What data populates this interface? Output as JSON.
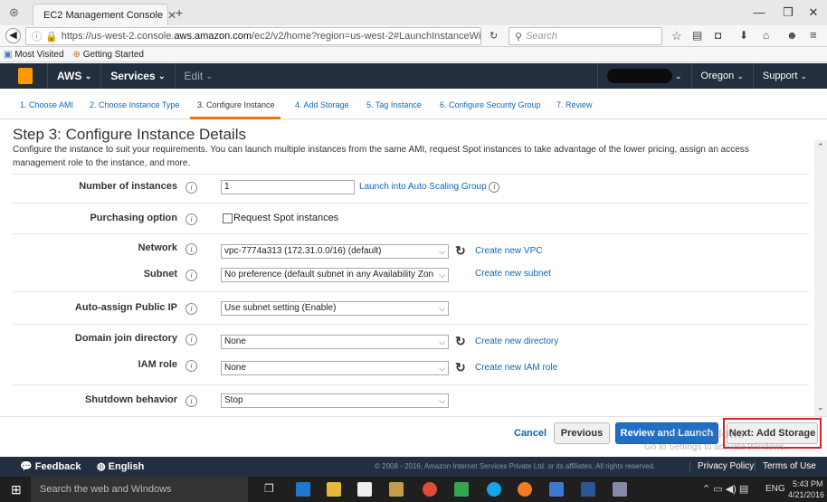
{
  "browser": {
    "tab_title": "EC2 Management Console",
    "url_prefix": "https://us-west-2.console.",
    "url_domain": "aws.amazon.com",
    "url_suffix": "/ec2/v2/home?region=us-west-2#LaunchInstanceWizard:",
    "search_placeholder": "Search",
    "bookmarks": [
      "Most Visited",
      "Getting Started"
    ]
  },
  "aws_nav": {
    "aws_label": "AWS",
    "services_label": "Services",
    "edit_label": "Edit",
    "region_label": "Oregon",
    "support_label": "Support"
  },
  "wizard": {
    "steps": [
      "1. Choose AMI",
      "2. Choose Instance Type",
      "3. Configure Instance",
      "4. Add Storage",
      "5. Tag Instance",
      "6. Configure Security Group",
      "7. Review"
    ],
    "active_step": 3,
    "heading": "Step 3: Configure Instance Details",
    "description": "Configure the instance to suit your requirements. You can launch multiple instances from the same AMI, request Spot instances to take advantage of the lower pricing, assign an access management role to the instance, and more."
  },
  "form": {
    "number_of_instances_label": "Number of instances",
    "number_of_instances_value": "1",
    "launch_asg_link": "Launch into Auto Scaling Group",
    "purchasing_option_label": "Purchasing option",
    "spot_checkbox_label": "Request Spot instances",
    "network_label": "Network",
    "network_value": "vpc-7774a313 (172.31.0.0/16) (default)",
    "create_vpc_link": "Create new VPC",
    "subnet_label": "Subnet",
    "subnet_value": "No preference (default subnet in any Availability Zon",
    "create_subnet_link": "Create new subnet",
    "public_ip_label": "Auto-assign Public IP",
    "public_ip_value": "Use subnet setting (Enable)",
    "domain_label": "Domain join directory",
    "domain_value": "None",
    "create_directory_link": "Create new directory",
    "iam_label": "IAM role",
    "iam_value": "None",
    "create_iam_link": "Create new IAM role",
    "shutdown_label": "Shutdown behavior",
    "shutdown_value": "Stop"
  },
  "buttons": {
    "cancel": "Cancel",
    "previous": "Previous",
    "review_launch": "Review and Launch",
    "next": "Next: Add Storage"
  },
  "watermark": {
    "line1": "Activate Windows",
    "line2": "Go to Settings to activate Windows."
  },
  "footer": {
    "feedback": "Feedback",
    "language": "English",
    "copyright": "© 2008 - 2016, Amazon Internet Services Private Ltd. or its affiliates. All rights reserved.",
    "privacy": "Privacy Policy",
    "terms": "Terms of Use"
  },
  "taskbar": {
    "search_placeholder": "Search the web and Windows",
    "lang": "ENG",
    "time": "5:43 PM",
    "date": "4/21/2016"
  },
  "colors": {
    "aws_nav_bg": "#232f3e",
    "accent_orange": "#e47911",
    "link_blue": "#1166bb",
    "primary_button": "#1f6fc5",
    "highlight_red": "#e02020"
  }
}
